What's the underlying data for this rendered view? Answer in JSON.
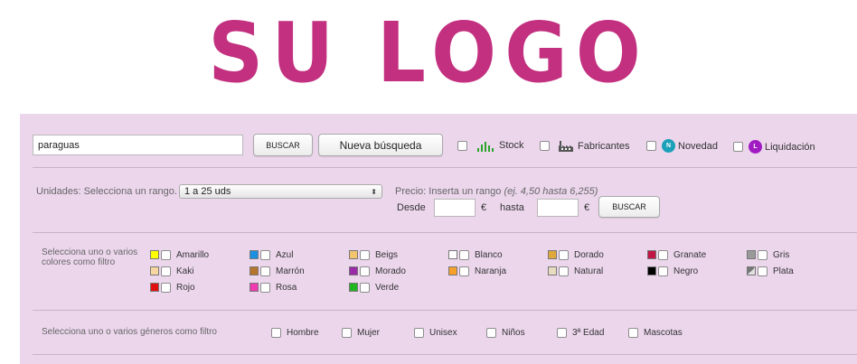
{
  "logo": {
    "text": "SU LOGO",
    "color": "#c2307f"
  },
  "panel_bg": "#ecd6ec",
  "search": {
    "value": "paraguas",
    "search_button": "BUSCAR",
    "new_search_button": "Nueva búsqueda",
    "filters": [
      {
        "label": "Stock",
        "icon": "stock-bars-icon"
      },
      {
        "label": "Fabricantes",
        "icon": "factory-icon"
      },
      {
        "label": "Novedad",
        "icon": "novedad-badge-icon",
        "badge": "N",
        "badge_color": "#1aa0b8"
      },
      {
        "label": "Liquidación",
        "icon": "liquidacion-badge-icon",
        "badge": "L",
        "badge_color": "#a11bc2"
      }
    ]
  },
  "units": {
    "label": "Unidades: Selecciona un rango.",
    "selected": "1 a 25 uds"
  },
  "price": {
    "label": "Precio: Inserta un rango",
    "example": "(ej. 4,50 hasta 6,255)",
    "from_label": "Desde",
    "to_label": "hasta",
    "currency": "€",
    "from_value": "",
    "to_value": "",
    "search_button": "BUSCAR"
  },
  "colors": {
    "label": "Selecciona uno o varios colores como filtro",
    "items": [
      {
        "name": "Amarillo",
        "hex": "#ffff00"
      },
      {
        "name": "Azul",
        "hex": "#1b8fe0"
      },
      {
        "name": "Beigs",
        "hex": "#f3c46e"
      },
      {
        "name": "Blanco",
        "hex": "#ffffff"
      },
      {
        "name": "Dorado",
        "hex": "#e0a83a"
      },
      {
        "name": "Granate",
        "hex": "#c01545"
      },
      {
        "name": "Gris",
        "hex": "#9a9a9a"
      },
      {
        "name": "Kaki",
        "hex": "#f7d6a0"
      },
      {
        "name": "Marrón",
        "hex": "#b5752e"
      },
      {
        "name": "Morado",
        "hex": "#9b2aa8"
      },
      {
        "name": "Naranja",
        "hex": "#f5a02a"
      },
      {
        "name": "Natural",
        "hex": "#e8dcc0"
      },
      {
        "name": "Negro",
        "hex": "#000000"
      },
      {
        "name": "Plata",
        "hex": "#c8c8c8"
      },
      {
        "name": "Rojo",
        "hex": "#e01010"
      },
      {
        "name": "Rosa",
        "hex": "#f03ab0"
      },
      {
        "name": "Verde",
        "hex": "#22b522"
      }
    ]
  },
  "genders": {
    "label": "Selecciona uno o varios géneros como filtro",
    "items": [
      "Hombre",
      "Mujer",
      "Unisex",
      "Niños",
      "3ª Edad",
      "Mascotas"
    ]
  }
}
